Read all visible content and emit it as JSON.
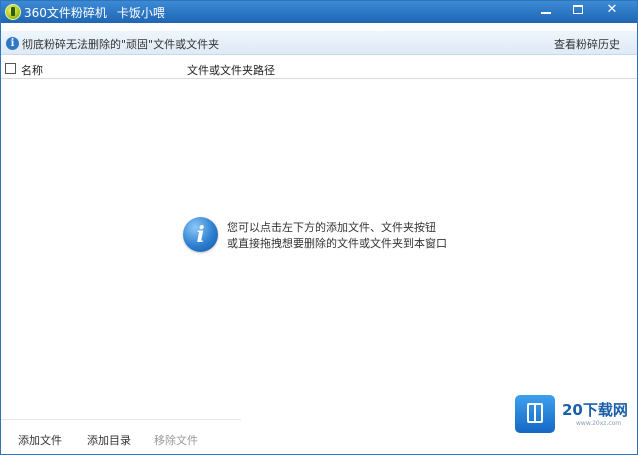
{
  "window": {
    "app_name": "360文件粉碎机",
    "subtitle": "卡饭小喂",
    "minimize_glyph": "minimize-icon",
    "maximize_glyph": "maximize-icon",
    "close_glyph": "✕"
  },
  "infobar": {
    "message": "彻底粉碎无法删除的\"顽固\"文件或文件夹",
    "history_link": "查看粉碎历史"
  },
  "table": {
    "columns": [
      "名称",
      "文件或文件夹路径"
    ]
  },
  "empty_state": {
    "icon": "info-icon",
    "icon_glyph": "i",
    "line1": "您可以点击左下方的添加文件、文件夹按钮",
    "line2": "或直接拖拽想要删除的文件或文件夹到本窗口"
  },
  "toolbar": {
    "add_file": "添加文件",
    "add_directory": "添加目录",
    "remove_file": "移除文件"
  },
  "watermark": {
    "brand": "20下载网",
    "url": "www.20xz.com"
  },
  "colors": {
    "titlebar": "#1f66b3",
    "accent": "#2f79c4",
    "disabled_text": "#999999"
  }
}
